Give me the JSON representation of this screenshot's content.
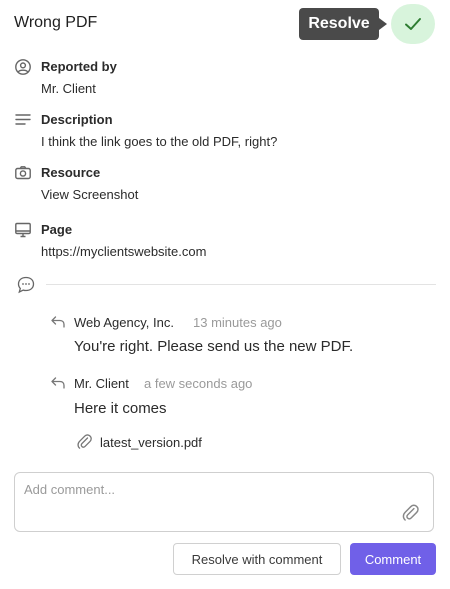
{
  "header": {
    "title": "Wrong PDF",
    "resolve_tooltip": "Resolve"
  },
  "fields": {
    "reported_by": {
      "label": "Reported by",
      "value": "Mr. Client"
    },
    "description": {
      "label": "Description",
      "value": "I think the link goes to the old PDF, right?"
    },
    "resource": {
      "label": "Resource",
      "value": "View Screenshot"
    },
    "page": {
      "label": "Page",
      "value": "https://myclientswebsite.com"
    }
  },
  "comments": [
    {
      "author": "Web Agency, Inc.",
      "time": "13 minutes ago",
      "text": "You're right. Please send us the new PDF."
    },
    {
      "author": "Mr. Client",
      "time": "a few seconds ago",
      "text": "Here it comes",
      "attachment": "latest_version.pdf"
    }
  ],
  "composer": {
    "placeholder": "Add comment...",
    "resolve_with_comment_label": "Resolve with comment",
    "comment_label": "Comment"
  },
  "colors": {
    "accent": "#7060e8",
    "resolve_bg": "#d8f4dc",
    "resolve_check": "#2e7d32",
    "tooltip_bg": "#4a4a4a"
  }
}
